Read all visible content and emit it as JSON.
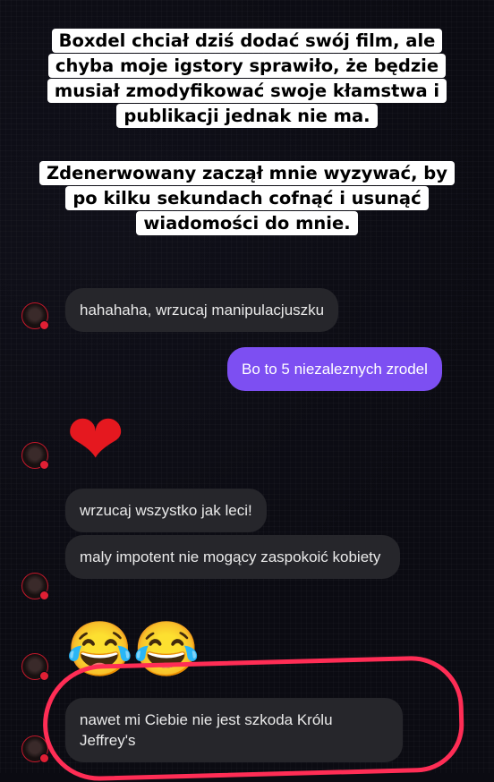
{
  "story_caption": {
    "top": [
      "Boxdel chciał dziś dodać swój film, ale",
      "chyba moje igstory sprawiło, że będzie",
      "musiał zmodyfikować swoje kłamstwa i",
      "publikacji jednak nie ma."
    ],
    "bottom": [
      "Zdenerwowany zaczął mnie wyzywać, by",
      "po kilku sekundach cofnąć i usunąć",
      "wiadomości do mnie."
    ]
  },
  "messages": [
    {
      "side": "in",
      "text": "hahahaha, wrzucaj manipulacjuszku"
    },
    {
      "side": "out",
      "text": "Bo to 5 niezaleznych zrodel"
    },
    {
      "side": "in",
      "emoji": "❤"
    },
    {
      "side": "in",
      "text": "wrzucaj wszystko jak leci!"
    },
    {
      "side": "in",
      "text": "maly impotent nie mogący zaspokoić kobiety"
    },
    {
      "side": "in",
      "emoji": "😂😂"
    },
    {
      "side": "in",
      "text": "nawet mi Ciebie nie jest szkoda Królu Jeffrey's"
    }
  ],
  "colors": {
    "outgoing_bubble": "#7d4ff2",
    "incoming_bubble": "#26262b",
    "highlight_ring": "#ff2d55"
  }
}
